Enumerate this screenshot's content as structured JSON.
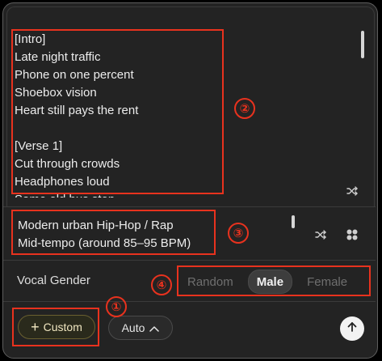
{
  "lyrics": {
    "lines": [
      "[Intro]",
      "Late night traffic",
      "Phone on one percent",
      "Shoebox vision",
      "Heart still pays the rent",
      "",
      "[Verse 1]",
      "Cut through crowds",
      "Headphones loud",
      "Same old bus stop"
    ]
  },
  "style": {
    "line1": "Modern urban Hip-Hop / Rap",
    "line2": "Mid-tempo (around 85–95 BPM)"
  },
  "vocal": {
    "label": "Vocal Gender",
    "options": [
      "Random",
      "Male",
      "Female"
    ],
    "selected": "Male"
  },
  "toolbar": {
    "custom_label": "Custom",
    "auto_label": "Auto"
  },
  "annotations": [
    "①",
    "②",
    "③",
    "④"
  ],
  "icons": {
    "shuffle": "shuffle-icon",
    "grid": "grid-icon",
    "send": "arrow-up-icon",
    "chevron": "chevron-up-icon"
  },
  "colors": {
    "annotation": "#e8321e",
    "panel": "#232323"
  }
}
